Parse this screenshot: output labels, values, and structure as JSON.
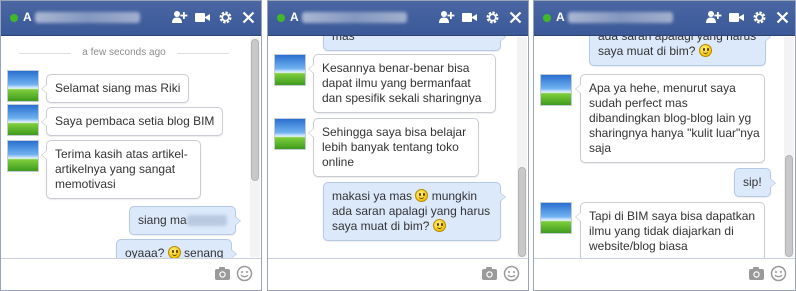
{
  "windows": [
    {
      "title_prefix": "A",
      "timestamp": "a few seconds ago",
      "messages": [
        {
          "text": "Selamat siang mas Riki"
        },
        {
          "text": "Saya pembaca setia blog BIM"
        },
        {
          "line1": "Terima kasih atas artikel-",
          "line2": "artikelnya yang sangat",
          "line3": "memotivasi"
        },
        {
          "text": "siang ma"
        },
        {
          "pre": "oyaaa? ",
          "post": " senang"
        }
      ]
    },
    {
      "title_prefix": "A",
      "messages": [
        {
          "text": "mas"
        },
        {
          "line1": "Kesannya benar-benar bisa",
          "line2": "dapat ilmu yang bermanfaat",
          "line3": "dan spesifik sekali sharingnya"
        },
        {
          "line1": "Sehingga saya bisa belajar",
          "line2": "lebih banyak tentang toko",
          "line3": "online"
        },
        {
          "line1_pre": "makasi ya mas ",
          "line1_post": " mungkin",
          "line2": "ada saran apalagi yang harus",
          "line3": "saya muat di bim? "
        }
      ]
    },
    {
      "title_prefix": "A",
      "messages": [
        {
          "line1": "ada saran apalagi yang harus",
          "line2": "saya muat di bim? "
        },
        {
          "line1": "Apa ya hehe, menurut saya",
          "line2": "sudah perfect mas",
          "line3": "dibandingkan blog-blog lain yg",
          "line4": "sharingnya hanya \"kulit luar\"nya",
          "line5": "saja"
        },
        {
          "text": "sip!"
        },
        {
          "line1": "Tapi di BIM saya bisa dapatkan",
          "line2": "ilmu yang tidak diajarkan di",
          "line3": "website/blog biasa"
        }
      ]
    }
  ],
  "icons": {
    "add_friend": "add-friend-icon",
    "video_call": "video-call-icon",
    "settings": "gear-icon",
    "close": "close-icon",
    "camera": "camera-icon",
    "emoji": "emoji-icon"
  },
  "colors": {
    "header": "#3b5998",
    "online": "#42b72a",
    "my_bubble": "#dbe9fb"
  }
}
